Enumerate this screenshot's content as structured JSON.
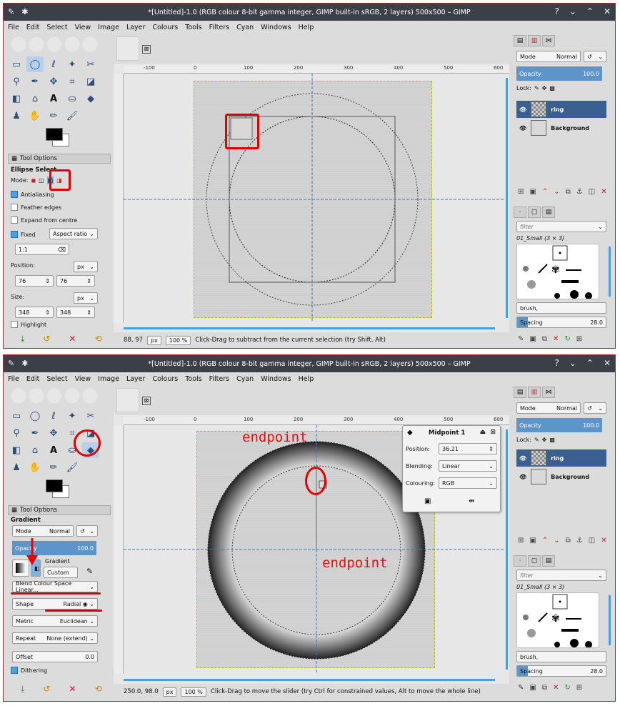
{
  "window1": {
    "title": "*[Untitled]-1.0 (RGB colour 8-bit gamma integer, GIMP built-in sRGB, 2 layers) 500x500 – GIMP",
    "menu": [
      "File",
      "Edit",
      "Select",
      "View",
      "Image",
      "Layer",
      "Colours",
      "Tools",
      "Filters",
      "Cyan",
      "Windows",
      "Help"
    ],
    "tool_options_tab": "Tool Options",
    "tool_name": "Ellipse Select",
    "mode_label": "Mode:",
    "antialiasing": "Antialiasing",
    "feather": "Feather edges",
    "expand": "Expand from centre",
    "fixed": "Fixed",
    "aspect": "Aspect ratio",
    "ratio": "1:1",
    "position_label": "Position:",
    "pos_unit": "px",
    "pos_x": "76",
    "pos_y": "76",
    "size_label": "Size:",
    "size_unit": "px",
    "size_w": "348",
    "size_h": "348",
    "highlight": "Highlight",
    "ruler_labels": [
      "-100",
      "0",
      "100",
      "200",
      "300",
      "400",
      "500",
      "600"
    ],
    "coords": "88, 97",
    "unit": "px",
    "zoom": "100 %",
    "status_msg": "Click-Drag to subtract from the current selection (try Shift, Alt)",
    "layers": {
      "mode_label": "Mode",
      "mode_value": "Normal",
      "opacity_label": "Opacity",
      "opacity_value": "100.0",
      "lock_label": "Lock:",
      "items": [
        "ring",
        "Background"
      ]
    },
    "brushes": {
      "filter_placeholder": "filter",
      "brush_name": "01_Small (3 × 3)",
      "brush_selected": "brush,",
      "spacing_label": "Spacing",
      "spacing_value": "28.0"
    }
  },
  "window2": {
    "title": "*[Untitled]-1.0 (RGB colour 8-bit gamma integer, GIMP built-in sRGB, 2 layers) 500x500 – GIMP",
    "menu": [
      "File",
      "Edit",
      "Select",
      "View",
      "Image",
      "Layer",
      "Colours",
      "Tools",
      "Filters",
      "Cyan",
      "Windows",
      "Help"
    ],
    "tool_options_tab": "Tool Options",
    "tool_name": "Gradient",
    "mode_label": "Mode",
    "mode_value": "Normal",
    "opacity_label": "Opacity",
    "opacity_value": "100.0",
    "gradient_label": "Gradient",
    "gradient_name": "Custom",
    "blend": "Blend Colour Space Linear...",
    "shape_label": "Shape",
    "shape_value": "Radial",
    "metric_label": "Metric",
    "metric_value": "Euclidean",
    "repeat_label": "Repeat",
    "repeat_value": "None (extend)",
    "offset_label": "Offset",
    "offset_value": "0.0",
    "dithering": "Dithering",
    "ruler_labels": [
      "-100",
      "0",
      "100",
      "200",
      "300",
      "400",
      "500",
      "600"
    ],
    "popup": {
      "title": "Midpoint 1",
      "position_label": "Position:",
      "position_value": "36.21",
      "blending_label": "Blending:",
      "blending_value": "Linear",
      "colouring_label": "Colouring:",
      "colouring_value": "RGB"
    },
    "annotation_top": "endpoint",
    "annotation_bottom": "endpoint",
    "coords": "250.0, 98.0",
    "unit": "px",
    "zoom": "100 %",
    "status_msg": "Click-Drag to move the slider (try Ctrl for constrained values, Alt to move the whole line)",
    "layers": {
      "mode_label": "Mode",
      "mode_value": "Normal",
      "opacity_label": "Opacity",
      "opacity_value": "100.0",
      "lock_label": "Lock:",
      "items": [
        "ring",
        "Background"
      ]
    },
    "brushes": {
      "filter_placeholder": "filter",
      "brush_name": "01_Small (3 × 3)",
      "brush_selected": "brush,",
      "spacing_label": "Spacing",
      "spacing_value": "28.0"
    }
  },
  "colors": {
    "accent": "#5d94c9",
    "annotation": "#e00000",
    "selected_layer": "#3b5f91",
    "titlebar": "#3b4048"
  }
}
